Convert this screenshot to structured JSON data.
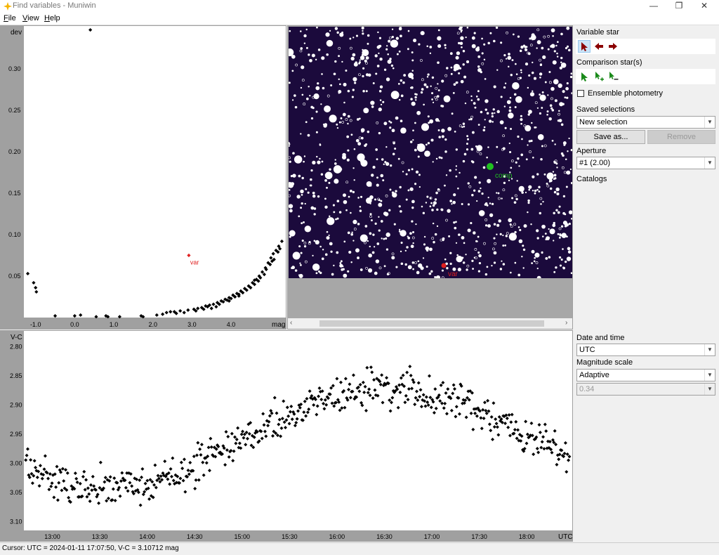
{
  "window": {
    "title": "Find variables - Muniwin",
    "minimize": "—",
    "maximize": "❐",
    "close": "✕"
  },
  "menu": [
    {
      "label": "File",
      "key": "F",
      "rest": "ile"
    },
    {
      "label": "View",
      "key": "V",
      "rest": "iew"
    },
    {
      "label": "Help",
      "key": "H",
      "rest": "elp"
    }
  ],
  "sidebar": {
    "variable_star_label": "Variable star",
    "comparison_label": "Comparison star(s)",
    "ensemble_label": "Ensemble photometry",
    "ensemble_checked": false,
    "saved_label": "Saved selections",
    "saved_value": "New selection",
    "save_as_label": "Save as...",
    "remove_label": "Remove",
    "aperture_label": "Aperture",
    "aperture_value": "#1 (2.00)",
    "catalogs_label": "Catalogs",
    "date_label": "Date and time",
    "date_value": "UTC",
    "mag_label": "Magnitude scale",
    "mag_value": "Adaptive",
    "mag_range_value": "0.34"
  },
  "status": {
    "text": "Cursor: UTC = 2024-01-11 17:07:50, V-C = 3.10712 mag"
  },
  "colors": {
    "sky": "#1b0a3c",
    "var_marker": "#e02020",
    "comp_marker": "#20c020",
    "axis_gray": "#a0a0a0"
  },
  "chart_data": [
    {
      "type": "scatter",
      "name": "mag-dev",
      "ylabel": "dev",
      "xlabel": "mag",
      "xlim": [
        -1.3,
        5.4
      ],
      "ylim": [
        0.0,
        0.35
      ],
      "xticks": [
        -1.0,
        0.0,
        1.0,
        2.0,
        3.0,
        4.0
      ],
      "xtick_labels": [
        "-1.0",
        "0.0",
        "1.0",
        "2.0",
        "3.0",
        "4.0"
      ],
      "yticks": [
        0.05,
        0.1,
        0.15,
        0.2,
        0.25,
        0.3
      ],
      "ytick_labels": [
        "0.05",
        "0.10",
        "0.15",
        "0.20",
        "0.25",
        "0.30"
      ],
      "highlight": {
        "label": "var",
        "x": 2.92,
        "y": 0.075
      },
      "points": [
        [
          -1.2,
          0.053
        ],
        [
          -1.05,
          0.042
        ],
        [
          -1.0,
          0.036
        ],
        [
          -0.98,
          0.031
        ],
        [
          -0.5,
          0.002
        ],
        [
          0.0,
          0.002
        ],
        [
          0.15,
          0.003
        ],
        [
          0.4,
          0.347
        ],
        [
          0.55,
          0.001
        ],
        [
          0.8,
          0.002
        ],
        [
          0.85,
          0.001
        ],
        [
          1.15,
          0.001
        ],
        [
          1.7,
          0.002
        ],
        [
          1.75,
          0.001
        ],
        [
          2.1,
          0.003
        ],
        [
          2.25,
          0.004
        ],
        [
          2.35,
          0.006
        ],
        [
          2.45,
          0.007
        ],
        [
          2.55,
          0.007
        ],
        [
          2.7,
          0.008
        ],
        [
          2.9,
          0.009
        ],
        [
          3.05,
          0.01
        ],
        [
          3.1,
          0.008
        ],
        [
          3.15,
          0.011
        ],
        [
          3.25,
          0.012
        ],
        [
          3.35,
          0.014
        ],
        [
          3.45,
          0.015
        ],
        [
          3.55,
          0.016
        ],
        [
          3.65,
          0.018
        ],
        [
          3.75,
          0.02
        ],
        [
          3.85,
          0.022
        ],
        [
          3.95,
          0.024
        ],
        [
          4.05,
          0.027
        ],
        [
          4.15,
          0.029
        ],
        [
          4.25,
          0.032
        ],
        [
          4.35,
          0.035
        ],
        [
          4.45,
          0.038
        ],
        [
          4.55,
          0.042
        ],
        [
          4.65,
          0.046
        ],
        [
          4.72,
          0.05
        ],
        [
          4.8,
          0.055
        ],
        [
          4.88,
          0.06
        ],
        [
          4.95,
          0.066
        ],
        [
          5.02,
          0.072
        ],
        [
          5.08,
          0.077
        ],
        [
          5.15,
          0.081
        ],
        [
          5.22,
          0.086
        ],
        [
          5.3,
          0.092
        ],
        [
          3.5,
          0.011
        ],
        [
          3.62,
          0.013
        ],
        [
          3.7,
          0.016
        ],
        [
          3.8,
          0.019
        ],
        [
          3.9,
          0.021
        ],
        [
          4.0,
          0.023
        ],
        [
          4.1,
          0.025
        ],
        [
          4.2,
          0.028
        ],
        [
          4.3,
          0.03
        ],
        [
          4.4,
          0.033
        ],
        [
          4.5,
          0.036
        ],
        [
          4.6,
          0.04
        ],
        [
          4.7,
          0.044
        ],
        [
          4.85,
          0.052
        ],
        [
          5.0,
          0.064
        ],
        [
          5.1,
          0.07
        ],
        [
          5.2,
          0.079
        ],
        [
          5.25,
          0.083
        ],
        [
          3.3,
          0.01
        ],
        [
          3.4,
          0.013
        ],
        [
          4.9,
          0.058
        ],
        [
          5.05,
          0.068
        ],
        [
          4.75,
          0.048
        ],
        [
          4.6,
          0.045
        ],
        [
          4.2,
          0.026
        ],
        [
          3.95,
          0.02
        ],
        [
          2.6,
          0.005
        ],
        [
          2.8,
          0.006
        ]
      ]
    },
    {
      "type": "scatter",
      "name": "light-curve",
      "ylabel": "V-C",
      "xlabel": "UTC",
      "ylim": [
        3.115,
        2.775
      ],
      "yticks": [
        2.8,
        2.85,
        2.9,
        2.95,
        3.0,
        3.05,
        3.1
      ],
      "ytick_labels": [
        "2.80",
        "2.85",
        "2.90",
        "2.95",
        "3.00",
        "3.05",
        "3.10"
      ],
      "xlim_hours": [
        12.7,
        18.48
      ],
      "xticks_hours": [
        13.0,
        13.5,
        14.0,
        14.5,
        15.0,
        15.5,
        16.0,
        16.5,
        17.0,
        17.5,
        18.0
      ],
      "xtick_labels": [
        "13:00",
        "13:30",
        "14:00",
        "14:30",
        "15:00",
        "15:30",
        "16:00",
        "16:30",
        "17:00",
        "17:30",
        "18:00"
      ],
      "model": {
        "period_hours": 6.0,
        "mean": 2.955,
        "amplitude": 0.085,
        "phase_hours": 13.55,
        "scatter": 0.04,
        "count": 560
      }
    }
  ]
}
